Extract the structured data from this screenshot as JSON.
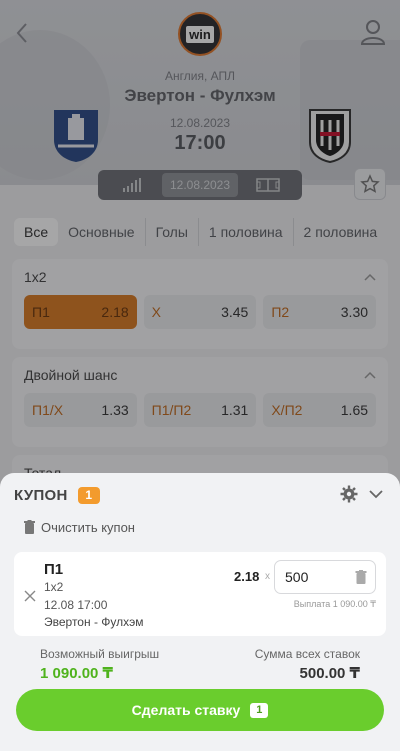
{
  "header": {
    "league": "Англия, АПЛ",
    "match_title": "Эвертон - Фулхэм",
    "date": "12.08.2023",
    "time": "17:00",
    "brand_logo_text": "win",
    "back_icon": "chevron-left-icon",
    "profile_icon": "user-icon",
    "favorite_icon": "star-icon"
  },
  "view_tabs": {
    "stats_icon": "bars-icon",
    "active_label": "12.08.2023",
    "field_icon": "field-icon"
  },
  "filters": [
    "Все",
    "Основные",
    "Голы",
    "1 половина",
    "2 половина"
  ],
  "markets": [
    {
      "title": "1x2",
      "odds": [
        {
          "label": "П1",
          "value": "2.18",
          "selected": true
        },
        {
          "label": "Х",
          "value": "3.45",
          "selected": false
        },
        {
          "label": "П2",
          "value": "3.30",
          "selected": false
        }
      ]
    },
    {
      "title": "Двойной шанс",
      "odds": [
        {
          "label": "П1/Х",
          "value": "1.33",
          "selected": false
        },
        {
          "label": "П1/П2",
          "value": "1.31",
          "selected": false
        },
        {
          "label": "Х/П2",
          "value": "1.65",
          "selected": false
        }
      ]
    },
    {
      "title": "Тотал"
    }
  ],
  "coupon": {
    "title": "КУПОН",
    "count": "1",
    "clear_label": "Очистить купон",
    "bet": {
      "pick": "П1",
      "market": "1x2",
      "datetime": "12.08 17:00",
      "teams": "Эвертон - Фулхэм",
      "coefficient": "2.18",
      "multiplier": "x",
      "stake": "500",
      "payout": "Выплата 1 090.00 ₸"
    },
    "possible_win_label": "Возможный выигрыш",
    "possible_win_value": "1 090.00 ₸",
    "total_stake_label": "Сумма всех ставок",
    "total_stake_value": "500.00 ₸",
    "place_bet_label": "Сделать ставку",
    "place_bet_count": "1"
  },
  "colors": {
    "accent_orange": "#d87a21",
    "success_green": "#6acd2d",
    "win_green": "#4fb31d"
  }
}
